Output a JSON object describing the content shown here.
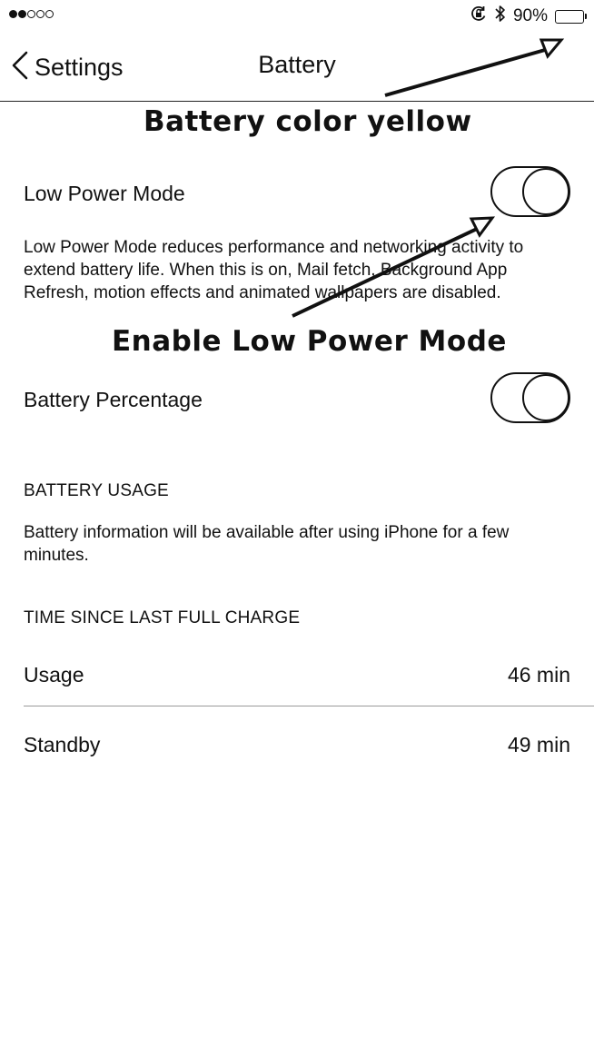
{
  "status_bar": {
    "signal_dots": [
      true,
      true,
      false,
      false,
      false
    ],
    "lock_rotation_icon": "orientation-lock-icon",
    "bluetooth_icon": "bluetooth-icon",
    "battery_percent_text": "90%",
    "battery_level": 0.9
  },
  "nav": {
    "back_label": "Settings",
    "title": "Battery"
  },
  "annotations": {
    "battery_note": "Battery color yellow",
    "toggle_note": "Enable Low Power Mode"
  },
  "low_power": {
    "label": "Low Power Mode",
    "enabled": false,
    "description": "Low Power Mode reduces performance and networking activity to extend battery life.  When this is on, Mail fetch, Background App Refresh, motion effects and animated wallpapers are disabled."
  },
  "battery_percentage": {
    "label": "Battery Percentage",
    "enabled": false
  },
  "battery_usage": {
    "header": "BATTERY USAGE",
    "message": "Battery information will be available after using iPhone for a few minutes."
  },
  "time_since_charge": {
    "header": "TIME SINCE LAST FULL CHARGE",
    "rows": [
      {
        "label": "Usage",
        "value": "46 min"
      },
      {
        "label": "Standby",
        "value": "49 min"
      }
    ]
  }
}
